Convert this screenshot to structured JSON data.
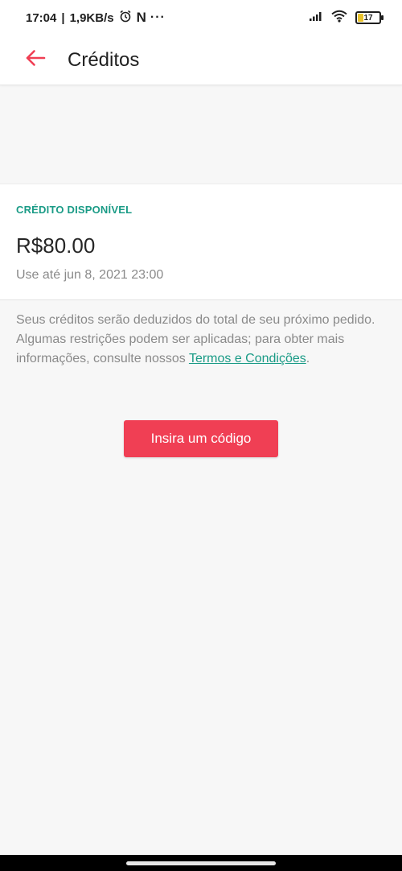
{
  "status_bar": {
    "time": "17:04",
    "speed": "1,9KB/s",
    "notification_letter": "N",
    "more": "···",
    "battery_level": "17",
    "colors": {
      "battery_fill": "#e9c22c"
    }
  },
  "app_bar": {
    "back_icon": "arrow-left-icon",
    "title": "Créditos",
    "colors": {
      "back_icon": "#f03f54"
    }
  },
  "credit": {
    "label": "CRÉDITO DISPONÍVEL",
    "amount": "R$80.00",
    "expiry": "Use até jun 8, 2021 23:00"
  },
  "info": {
    "text": "Seus créditos serão deduzidos do total de seu próximo pedido. Algumas restrições podem ser aplicadas; para obter mais informações, consulte nossos ",
    "link": "Termos e Condições",
    "suffix": "."
  },
  "actions": {
    "insert_code_label": "Insira um código"
  },
  "colors": {
    "accent": "#f03f54",
    "link": "#1a9b86",
    "background": "#f7f7f7"
  }
}
